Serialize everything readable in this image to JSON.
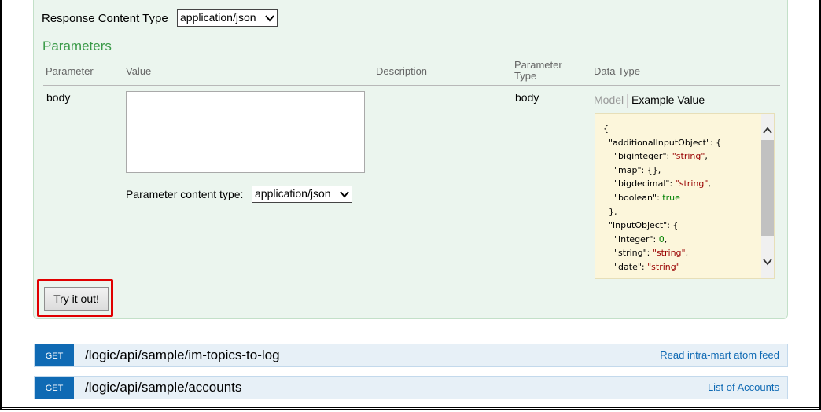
{
  "response_content_type": {
    "label": "Response Content Type",
    "value": "application/json"
  },
  "parameters": {
    "title": "Parameters",
    "headers": {
      "parameter": "Parameter",
      "value": "Value",
      "description": "Description",
      "parameter_type_line1": "Parameter",
      "parameter_type_line2": "Type",
      "data_type": "Data Type"
    },
    "row": {
      "name": "body",
      "value": "",
      "parameter_type": "body",
      "content_type_label": "Parameter content type:",
      "content_type_value": "application/json",
      "tab_model": "Model",
      "tab_example": "Example Value"
    },
    "example_lines": [
      [
        {
          "t": "{",
          "c": "p"
        }
      ],
      [
        {
          "t": "  \"additionalInputObject\": {",
          "c": "p"
        }
      ],
      [
        {
          "t": "    \"biginteger\": ",
          "c": "p"
        },
        {
          "t": "\"string\"",
          "c": "s"
        },
        {
          "t": ",",
          "c": "p"
        }
      ],
      [
        {
          "t": "    \"map\": {},",
          "c": "p"
        }
      ],
      [
        {
          "t": "    \"bigdecimal\": ",
          "c": "p"
        },
        {
          "t": "\"string\"",
          "c": "s"
        },
        {
          "t": ",",
          "c": "p"
        }
      ],
      [
        {
          "t": "    \"boolean\": ",
          "c": "p"
        },
        {
          "t": "true",
          "c": "b"
        }
      ],
      [
        {
          "t": "  },",
          "c": "p"
        }
      ],
      [
        {
          "t": "  \"inputObject\": {",
          "c": "p"
        }
      ],
      [
        {
          "t": "    \"integer\": ",
          "c": "p"
        },
        {
          "t": "0",
          "c": "b"
        },
        {
          "t": ",",
          "c": "p"
        }
      ],
      [
        {
          "t": "    \"string\": ",
          "c": "p"
        },
        {
          "t": "\"string\"",
          "c": "s"
        },
        {
          "t": ",",
          "c": "p"
        }
      ],
      [
        {
          "t": "    \"date\": ",
          "c": "p"
        },
        {
          "t": "\"string\"",
          "c": "s"
        }
      ],
      [
        {
          "t": "  }",
          "c": "p"
        }
      ]
    ]
  },
  "try_button": {
    "label": "Try it out!"
  },
  "endpoints": [
    {
      "method": "GET",
      "path": "/logic/api/sample/im-topics-to-log",
      "summary": "Read intra-mart atom feed"
    },
    {
      "method": "GET",
      "path": "/logic/api/sample/accounts",
      "summary": "List of Accounts"
    }
  ],
  "colors": {
    "panel_bg": "#ebf5ee",
    "section_title": "#3a9a48",
    "get_badge": "#0f6ab4",
    "example_bg": "#fcf6db",
    "highlight": "#e00000"
  }
}
